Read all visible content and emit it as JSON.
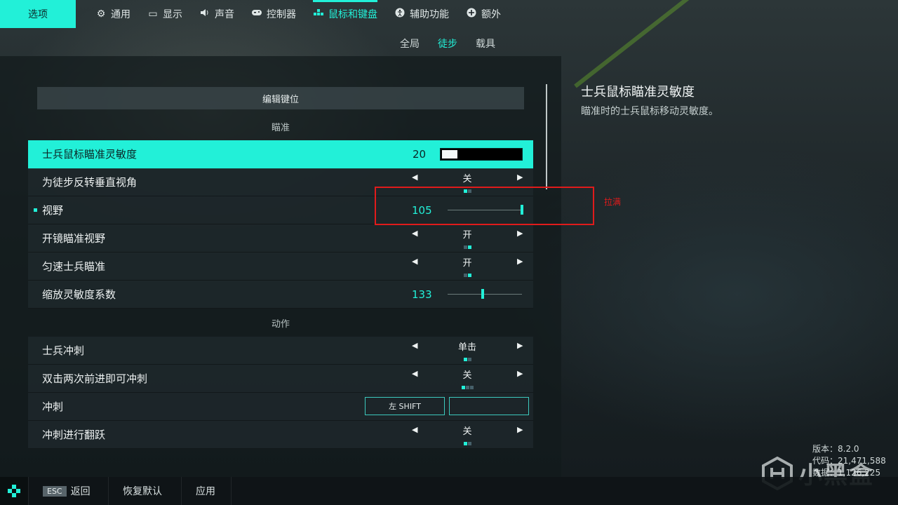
{
  "topbar": {
    "options_label": "选项",
    "nav": [
      {
        "label": "通用",
        "icon": "gear-icon",
        "glyph": "⚙"
      },
      {
        "label": "显示",
        "icon": "monitor-icon",
        "glyph": "▭"
      },
      {
        "label": "声音",
        "icon": "speaker-icon",
        "glyph": "🔊"
      },
      {
        "label": "控制器",
        "icon": "gamepad-icon",
        "glyph": "🎮"
      },
      {
        "label": "鼠标和键盘",
        "icon": "keyboard-icon",
        "glyph": "▪"
      },
      {
        "label": "辅助功能",
        "icon": "accessibility-icon",
        "glyph": "✪"
      },
      {
        "label": "额外",
        "icon": "plus-circle-icon",
        "glyph": "⊕"
      }
    ],
    "active_nav": "鼠标和键盘"
  },
  "subnav": {
    "items": [
      "全局",
      "徒步",
      "载具"
    ],
    "active": "徒步"
  },
  "settings": {
    "edit_keybinds": "编辑键位",
    "section_aim": "瞄准",
    "section_action": "动作",
    "rows": [
      {
        "label": "士兵鼠标瞄准灵敏度",
        "value": "20",
        "type": "bar",
        "level": 0.2
      },
      {
        "label": "为徒步反转垂直视角",
        "value": "关",
        "type": "toggle"
      },
      {
        "label": "视野",
        "value": "105",
        "type": "slider",
        "level": 1.0
      },
      {
        "label": "开镜瞄准视野",
        "value": "开",
        "type": "toggle"
      },
      {
        "label": "匀速士兵瞄准",
        "value": "开",
        "type": "toggle"
      },
      {
        "label": "缩放灵敏度系数",
        "value": "133",
        "type": "slider",
        "level": 0.47
      },
      {
        "label": "士兵冲刺",
        "value": "单击",
        "type": "toggle"
      },
      {
        "label": "双击两次前进即可冲刺",
        "value": "关",
        "type": "toggle"
      },
      {
        "label": "冲刺",
        "key1": "左 SHIFT",
        "key2": "",
        "type": "keybind"
      },
      {
        "label": "冲刺进行翻跃",
        "value": "关",
        "type": "toggle"
      }
    ]
  },
  "annotation": {
    "text": "拉满",
    "color": "#e01b1b"
  },
  "info": {
    "title": "士兵鼠标瞄准灵敏度",
    "description": "瞄准时的士兵鼠标移动灵敏度。"
  },
  "version": {
    "line1": "版本：8.2.0",
    "line2": "代码：21,471,588",
    "line3": "数据：1,126,225"
  },
  "watermark": {
    "text": "小黑盒"
  },
  "bottombar": {
    "esc_key": "ESC",
    "back": "返回",
    "reset": "恢复默认",
    "apply": "应用"
  },
  "colors": {
    "accent": "#22f0d8",
    "panel": "#1e282c"
  }
}
